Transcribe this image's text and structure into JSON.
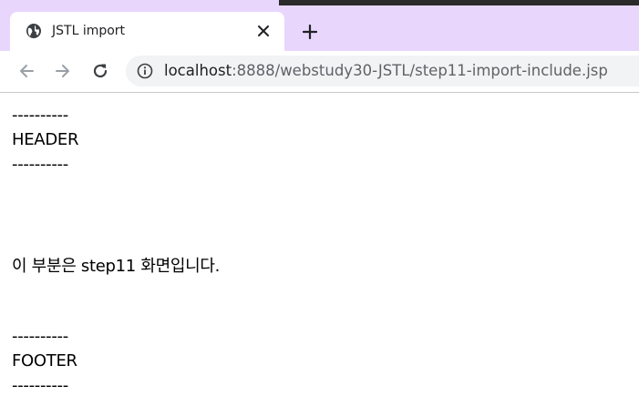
{
  "browser": {
    "tab": {
      "title": "JSTL import"
    },
    "new_tab": "+",
    "address": {
      "host": "localhost",
      "path": ":8888/webstudy30-JSTL/step11-import-include.jsp"
    }
  },
  "page": {
    "header_rule_top": "----------",
    "header_text": "HEADER",
    "header_rule_bottom": "----------",
    "body_text": "이 부분은 step11 화면입니다.",
    "footer_rule_top": "----------",
    "footer_text": "FOOTER",
    "footer_rule_bottom": "----------"
  },
  "colors": {
    "tabstrip": "#e8d6fd",
    "omnibox": "#f1f3f4"
  }
}
